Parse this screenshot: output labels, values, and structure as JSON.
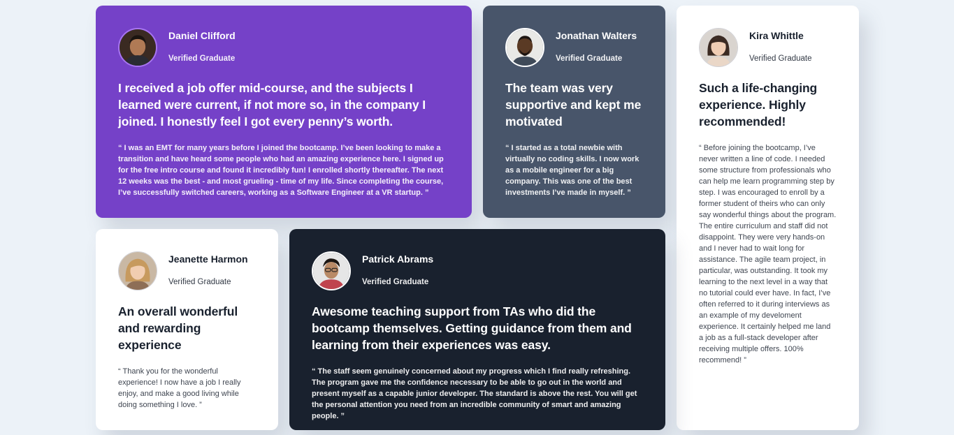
{
  "testimonials": [
    {
      "name": "Daniel Clifford",
      "role": "Verified Graduate",
      "headline": "I received a job offer mid-course, and the subjects I learned were current, if not more so, in the company I joined. I honestly feel I got every penny’s worth.",
      "quote": "“ I was an EMT for many years before I joined the bootcamp. I’ve been looking to make a transition and have heard some people who had an amazing experience here. I signed up for the free intro course and found it incredibly fun! I enrolled shortly thereafter. The next 12 weeks was the best - and most grueling - time of my life. Since completing the course, I’ve successfully switched careers, working as a Software Engineer at a VR startup. ”",
      "color": "#7541c8"
    },
    {
      "name": "Jonathan Walters",
      "role": "Verified Graduate",
      "headline": "The team was very supportive and kept me motivated",
      "quote": "“ I started as a total newbie with virtually no coding skills. I now work as a mobile engineer for a big company. This was one of the best investments I’ve made in myself. ”",
      "color": "#48556a"
    },
    {
      "name": "Kira Whittle",
      "role": "Verified Graduate",
      "headline": "Such a life-changing experience. Highly recommended!",
      "quote": "“ Before joining the bootcamp, I’ve never written a line of code. I needed some structure from professionals who can help me learn programming step by step. I was encouraged to enroll by a former student of theirs who can only say wonderful things about the program. The entire curriculum and staff did not disappoint. They were very hands-on and I never had to wait long for assistance. The agile team project, in particular, was outstanding. It took my learning to the next level in a way that no tutorial could ever have. In fact, I’ve often referred to it during interviews as an example of my develoment experience. It certainly helped me land a job as a full-stack developer after receiving multiple offers. 100% recommend! ”",
      "color": "#ffffff"
    },
    {
      "name": "Jeanette Harmon",
      "role": "Verified Graduate",
      "headline": "An overall wonderful and rewarding experience",
      "quote": "“ Thank you for the wonderful experience! I now have a job I really enjoy, and make a good living while doing something I love. ”",
      "color": "#ffffff"
    },
    {
      "name": "Patrick Abrams",
      "role": "Verified Graduate",
      "headline": "Awesome teaching support from TAs who did the bootcamp themselves. Getting guidance from them and learning from their experiences was easy.",
      "quote": "“ The staff seem genuinely concerned about my progress which I find really refreshing. The program gave me the confidence necessary to be able to go out in the world and present myself as a capable junior developer. The standard is above the rest. You will get the personal attention you need from an incredible community of smart and amazing people. ”",
      "color": "#19212e"
    }
  ]
}
